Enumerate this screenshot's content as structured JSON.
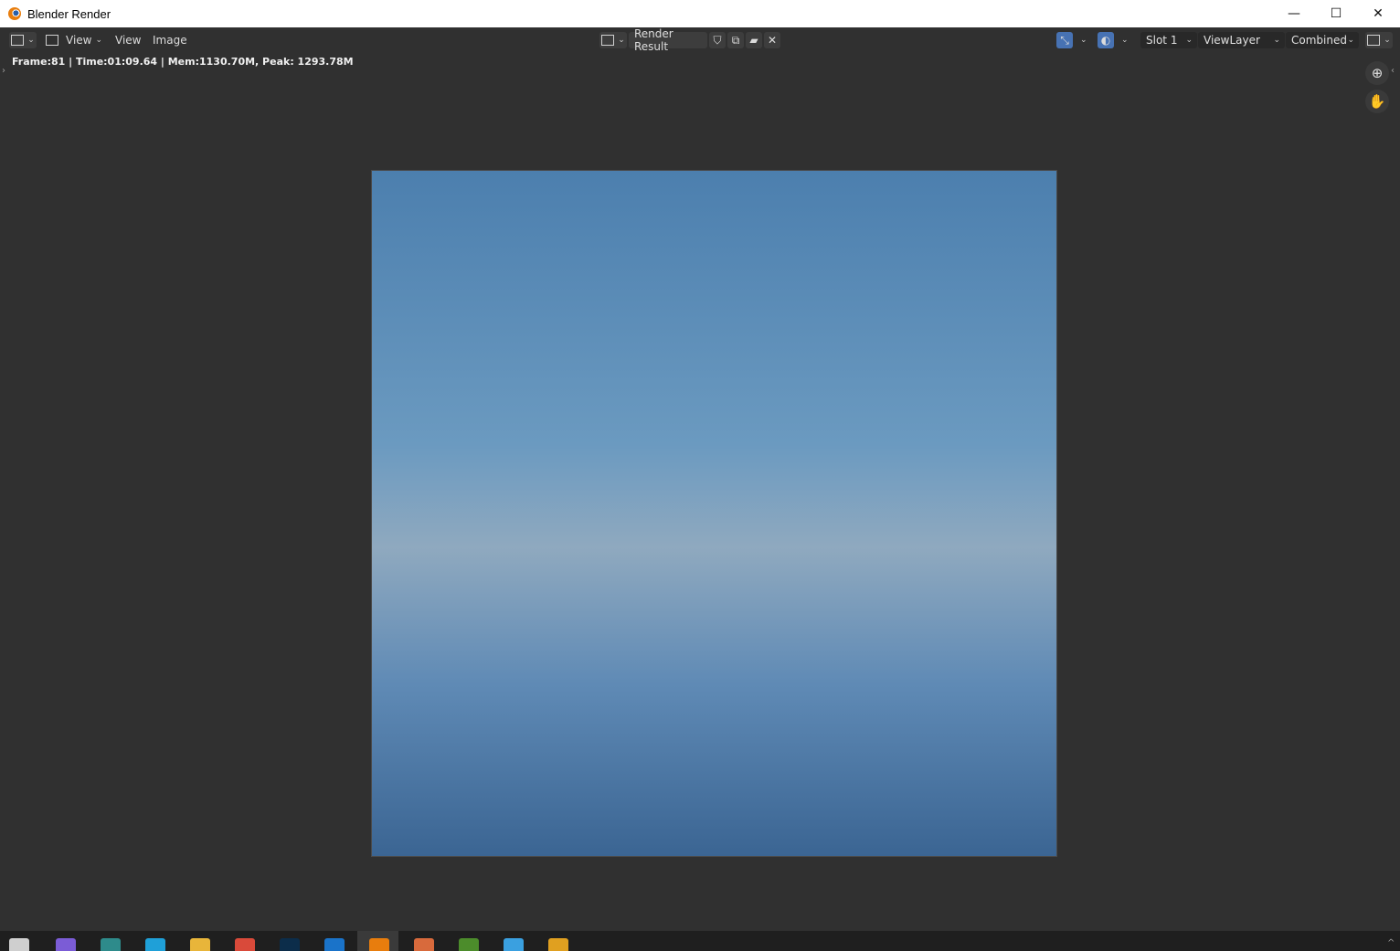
{
  "window": {
    "title": "Blender Render",
    "controls": {
      "minimize": "—",
      "maximize": "☐",
      "close": "✕"
    }
  },
  "header": {
    "view_menu_label": "View",
    "view_menu2_label": "View",
    "image_menu_label": "Image",
    "image_name": "Render Result",
    "slot": "Slot 1",
    "view_layer": "ViewLayer",
    "pass": "Combined"
  },
  "status_line": "Frame:81 | Time:01:09.64 | Mem:1130.70M, Peak: 1293.78M",
  "canvas": {
    "placeholder": ""
  },
  "colors": {
    "accent": "#4772b3",
    "panel": "#303030",
    "field": "#282828"
  },
  "icons": [
    "editor-type-icon",
    "image-mode-icon",
    "shield-icon",
    "duplicate-icon",
    "open-folder-icon",
    "close-icon",
    "gizmo-icon",
    "overlay-icon",
    "display-channels-icon",
    "zoom-icon",
    "hand-pan-icon"
  ]
}
